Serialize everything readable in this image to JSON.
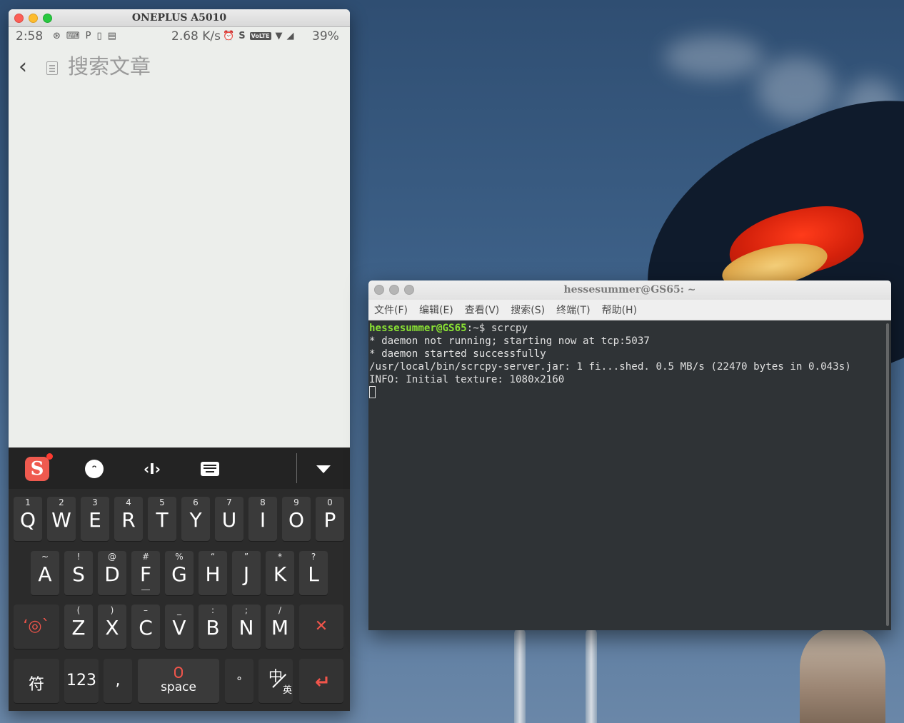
{
  "phone": {
    "window_title": "ONEPLUS A5010",
    "status": {
      "time": "2:58",
      "speed": "2.68 K/s",
      "volte": "VoLTE",
      "battery": "39%"
    },
    "appbar": {
      "search_placeholder": "搜索文章"
    },
    "keyboard": {
      "toolbar_logo": "S",
      "row1": [
        {
          "sup": "1",
          "main": "Q"
        },
        {
          "sup": "2",
          "main": "W"
        },
        {
          "sup": "3",
          "main": "E"
        },
        {
          "sup": "4",
          "main": "R"
        },
        {
          "sup": "5",
          "main": "T"
        },
        {
          "sup": "6",
          "main": "Y"
        },
        {
          "sup": "7",
          "main": "U"
        },
        {
          "sup": "8",
          "main": "I"
        },
        {
          "sup": "9",
          "main": "O"
        },
        {
          "sup": "0",
          "main": "P"
        }
      ],
      "row2": [
        {
          "sup": "~",
          "main": "A"
        },
        {
          "sup": "!",
          "main": "S"
        },
        {
          "sup": "@",
          "main": "D"
        },
        {
          "sup": "#",
          "main": "F"
        },
        {
          "sup": "%",
          "main": "G"
        },
        {
          "sup": "“",
          "main": "H"
        },
        {
          "sup": "”",
          "main": "J"
        },
        {
          "sup": "*",
          "main": "K"
        },
        {
          "sup": "?",
          "main": "L"
        }
      ],
      "row3": [
        {
          "sup": "(",
          "main": "Z"
        },
        {
          "sup": ")",
          "main": "X"
        },
        {
          "sup": "–",
          "main": "C"
        },
        {
          "sup": "_",
          "main": "V"
        },
        {
          "sup": ":",
          "main": "B"
        },
        {
          "sup": ";",
          "main": "N"
        },
        {
          "sup": "/",
          "main": "M"
        }
      ],
      "row3_emoticon": "ʻ◎ˋ",
      "delete": "✕",
      "symbols": "符",
      "numbers": "123",
      "comma": ",",
      "space": "space",
      "period": "°",
      "lang_a": "中",
      "lang_b": "英",
      "enter": "↵"
    }
  },
  "terminal": {
    "title": "hessesummer@GS65: ~",
    "menu": [
      "文件(F)",
      "编辑(E)",
      "查看(V)",
      "搜索(S)",
      "终端(T)",
      "帮助(H)"
    ],
    "prompt_user": "hessesummer@GS65",
    "prompt_path": ":~$ ",
    "command": "scrcpy",
    "lines": [
      "* daemon not running; starting now at tcp:5037",
      "* daemon started successfully",
      "/usr/local/bin/scrcpy-server.jar: 1 fi...shed. 0.5 MB/s (22470 bytes in 0.043s)",
      "INFO: Initial texture: 1080x2160"
    ]
  }
}
